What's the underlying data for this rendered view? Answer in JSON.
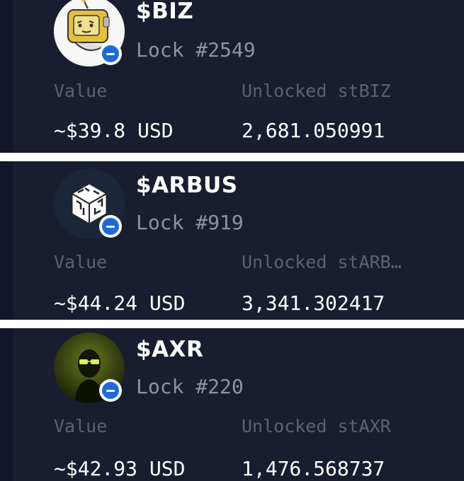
{
  "locks": [
    {
      "ticker": "$BIZ",
      "lock": "Lock #2549",
      "value_label": "Value",
      "unlocked_label": "Unlocked stBIZ",
      "value": "~$39.8 USD",
      "unlocked": "2,681.050991",
      "avatar_icon": "robot-tv-character-icon",
      "badge_icon": "minus-circle-icon"
    },
    {
      "ticker": "$ARBUS",
      "lock": "Lock #919",
      "value_label": "Value",
      "unlocked_label": "Unlocked stARB…",
      "value": "~$44.24 USD",
      "unlocked": "3,341.302417",
      "avatar_icon": "maze-cube-icon",
      "badge_icon": "minus-circle-icon"
    },
    {
      "ticker": "$AXR",
      "lock": "Lock #220",
      "value_label": "Value",
      "unlocked_label": "Unlocked stAXR",
      "value": "~$42.93 USD",
      "unlocked": "1,476.568737",
      "avatar_icon": "glasses-figure-icon",
      "badge_icon": "minus-circle-icon"
    }
  ],
  "colors": {
    "card_bg": "#181d2f",
    "label": "#5c6275",
    "lock_text": "#8d93a6",
    "badge_blue": "#1e6bd8"
  }
}
